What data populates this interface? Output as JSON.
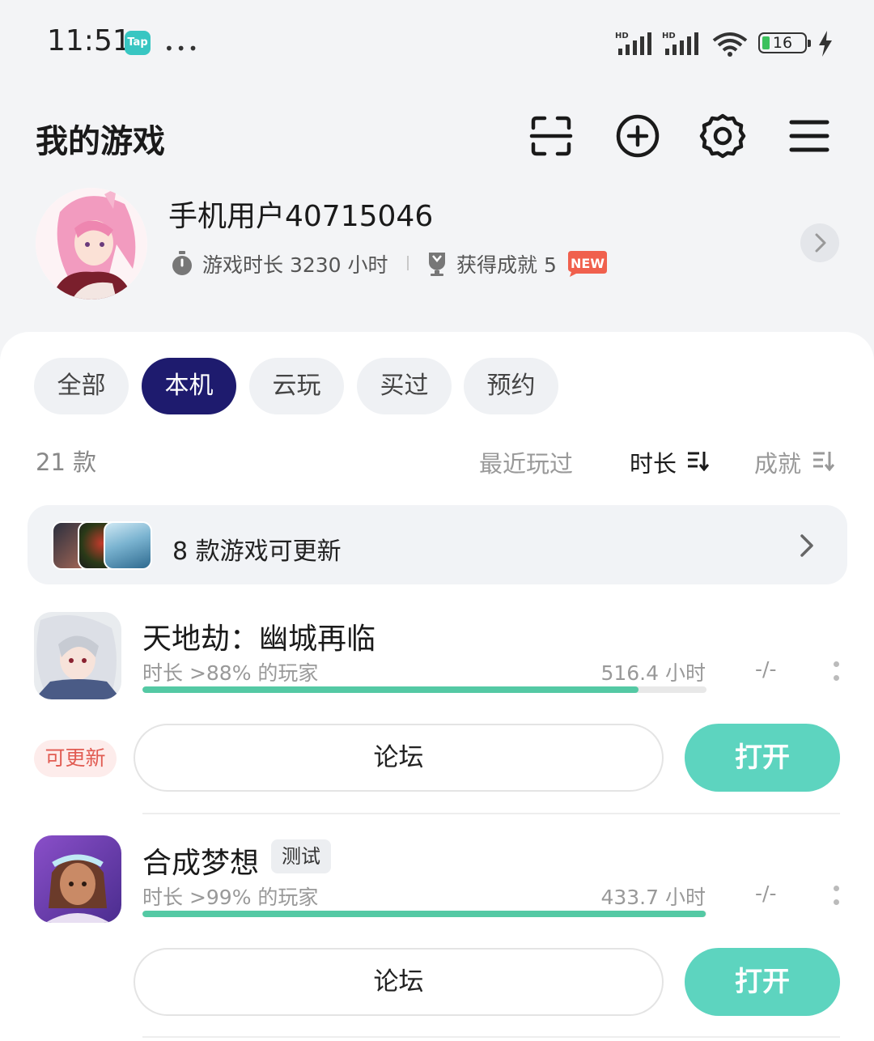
{
  "status_bar": {
    "time": "11:51",
    "app_badge": "Tap",
    "more": "•••",
    "battery": "16",
    "accent_battery": "#3cc15d"
  },
  "header": {
    "title": "我的游戏",
    "icons": [
      "scan-icon",
      "add-circle-icon",
      "gear-icon",
      "menu-icon"
    ]
  },
  "profile": {
    "username": "手机用户40715046",
    "playtime": "游戏时长 3230 小时",
    "achievements": "获得成就 5",
    "new_badge": "NEW"
  },
  "tabs": [
    {
      "label": "全部",
      "active": false
    },
    {
      "label": "本机",
      "active": true
    },
    {
      "label": "云玩",
      "active": false
    },
    {
      "label": "买过",
      "active": false
    },
    {
      "label": "预约",
      "active": false
    }
  ],
  "list_header": {
    "count": "21 款",
    "sort_recent": "最近玩过",
    "sort_duration": "时长",
    "sort_achievement": "成就"
  },
  "update_banner": {
    "text": "8 款游戏可更新"
  },
  "games": [
    {
      "name": "天地劫：幽城再临",
      "stat": "时长 >88% 的玩家",
      "hours": "516.4 小时",
      "progress": 0.88,
      "achievement": "-/-",
      "update_tag": "可更新",
      "forum_label": "论坛",
      "open_label": "打开"
    },
    {
      "name": "合成梦想",
      "tag": "测试",
      "stat": "时长 >99% 的玩家",
      "hours": "433.7 小时",
      "progress": 0.999,
      "achievement": "-/-",
      "forum_label": "论坛",
      "open_label": "打开"
    }
  ],
  "colors": {
    "active_tab": "#1e1b6e",
    "open_button": "#5dd4bf",
    "progress": "#54c9a4",
    "update_tag_text": "#e15b52"
  }
}
